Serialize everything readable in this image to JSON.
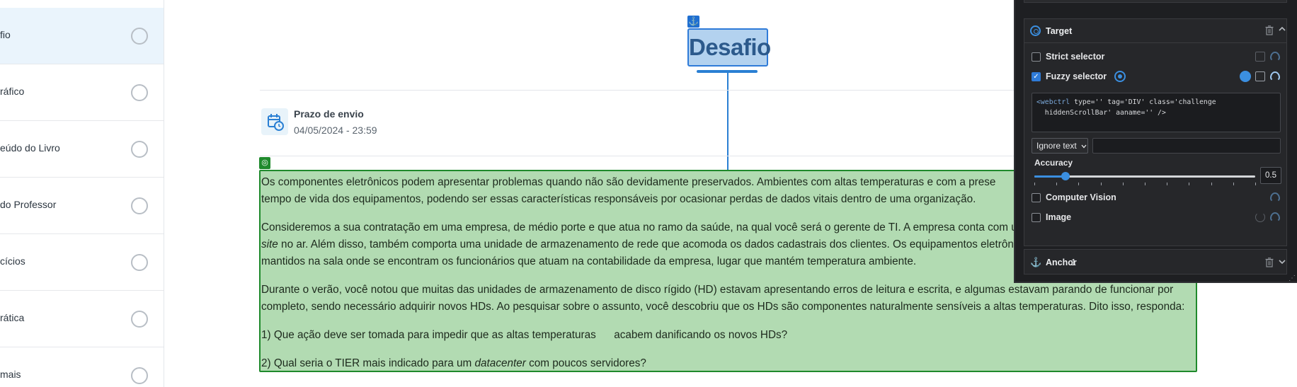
{
  "sidebar": {
    "items": [
      {
        "label": "fio",
        "active": true
      },
      {
        "label": "ráfico",
        "active": false
      },
      {
        "label": "eúdo do Livro",
        "active": false
      },
      {
        "label": "do Professor",
        "active": false
      },
      {
        "label": "cícios",
        "active": false
      },
      {
        "label": "rática",
        "active": false
      },
      {
        "label": "mais",
        "active": false
      }
    ]
  },
  "main": {
    "title": "Desafio",
    "deadline_label": "Prazo de envio",
    "deadline_value": "04/05/2024 - 23:59",
    "paragraphs": [
      [
        "Os componentes eletrônicos podem apresentar problemas quando não são devidamente preservados. Ambientes com altas temperaturas e com a prese",
        "tempo de vida dos equipamentos, podendo ser essas características responsáveis por ocasionar perdas de dados vitais dentro de uma organização."
      ],
      [
        "Consideremos a sua contratação em uma empresa, de médio porte e que atua no ramo da saúde, na qual você será o gerente de TI. A empresa conta com u",
        "site",
        " no ar. Além disso, também comporta uma unidade de armazenamento de rede que acomoda os dados cadastrais dos clientes. Os equipamentos eletrôn",
        "mantidos na sala onde se encontram os funcionários que atuam na contabilidade da empresa, lugar que mantém temperatura ambiente."
      ],
      [
        "Durante o verão, você notou que muitas das unidades de armazenamento de disco rígido (HD) estavam apresentando erros de leitura e escrita, e algumas estavam parando de funcionar por",
        "completo, sendo necessário adquirir novos HDs. Ao pesquisar sobre o assunto, você descobriu que os HDs são componentes naturalmente sensíveis a  altas temperaturas. Dito isso, responda:"
      ],
      [
        "1) Que ação deve ser tomada para impedir que as altas temperaturas      acabem danificando os novos HDs?"
      ],
      [
        "2) Qual seria o TIER mais indicado para um ",
        "datacenter",
        " com poucos servidores?"
      ]
    ]
  },
  "panel": {
    "target_section": {
      "title": "Target",
      "strict_selector": {
        "label": "Strict selector",
        "checked": false
      },
      "fuzzy_selector": {
        "label": "Fuzzy selector",
        "checked": true
      },
      "code_line1_tag": "<webctrl",
      "code_line1_rest": " type='' tag='DIV' class='challenge",
      "code_line2": "  hiddenScrollBar' aaname='' />",
      "ignore_select": "Ignore text",
      "ignore_value": "",
      "accuracy_label": "Accuracy",
      "accuracy_value": "0.5",
      "accuracy_fraction": 0.14,
      "computer_vision": {
        "label": "Computer Vision",
        "checked": false
      },
      "image": {
        "label": "Image",
        "checked": false
      }
    },
    "anchor_section": {
      "title": "Anchor",
      "count": "1"
    },
    "colors": {
      "accent": "#3b8fe0",
      "highlight_green": "#b2dbb2",
      "highlight_blue": "#b3d2ef"
    }
  }
}
